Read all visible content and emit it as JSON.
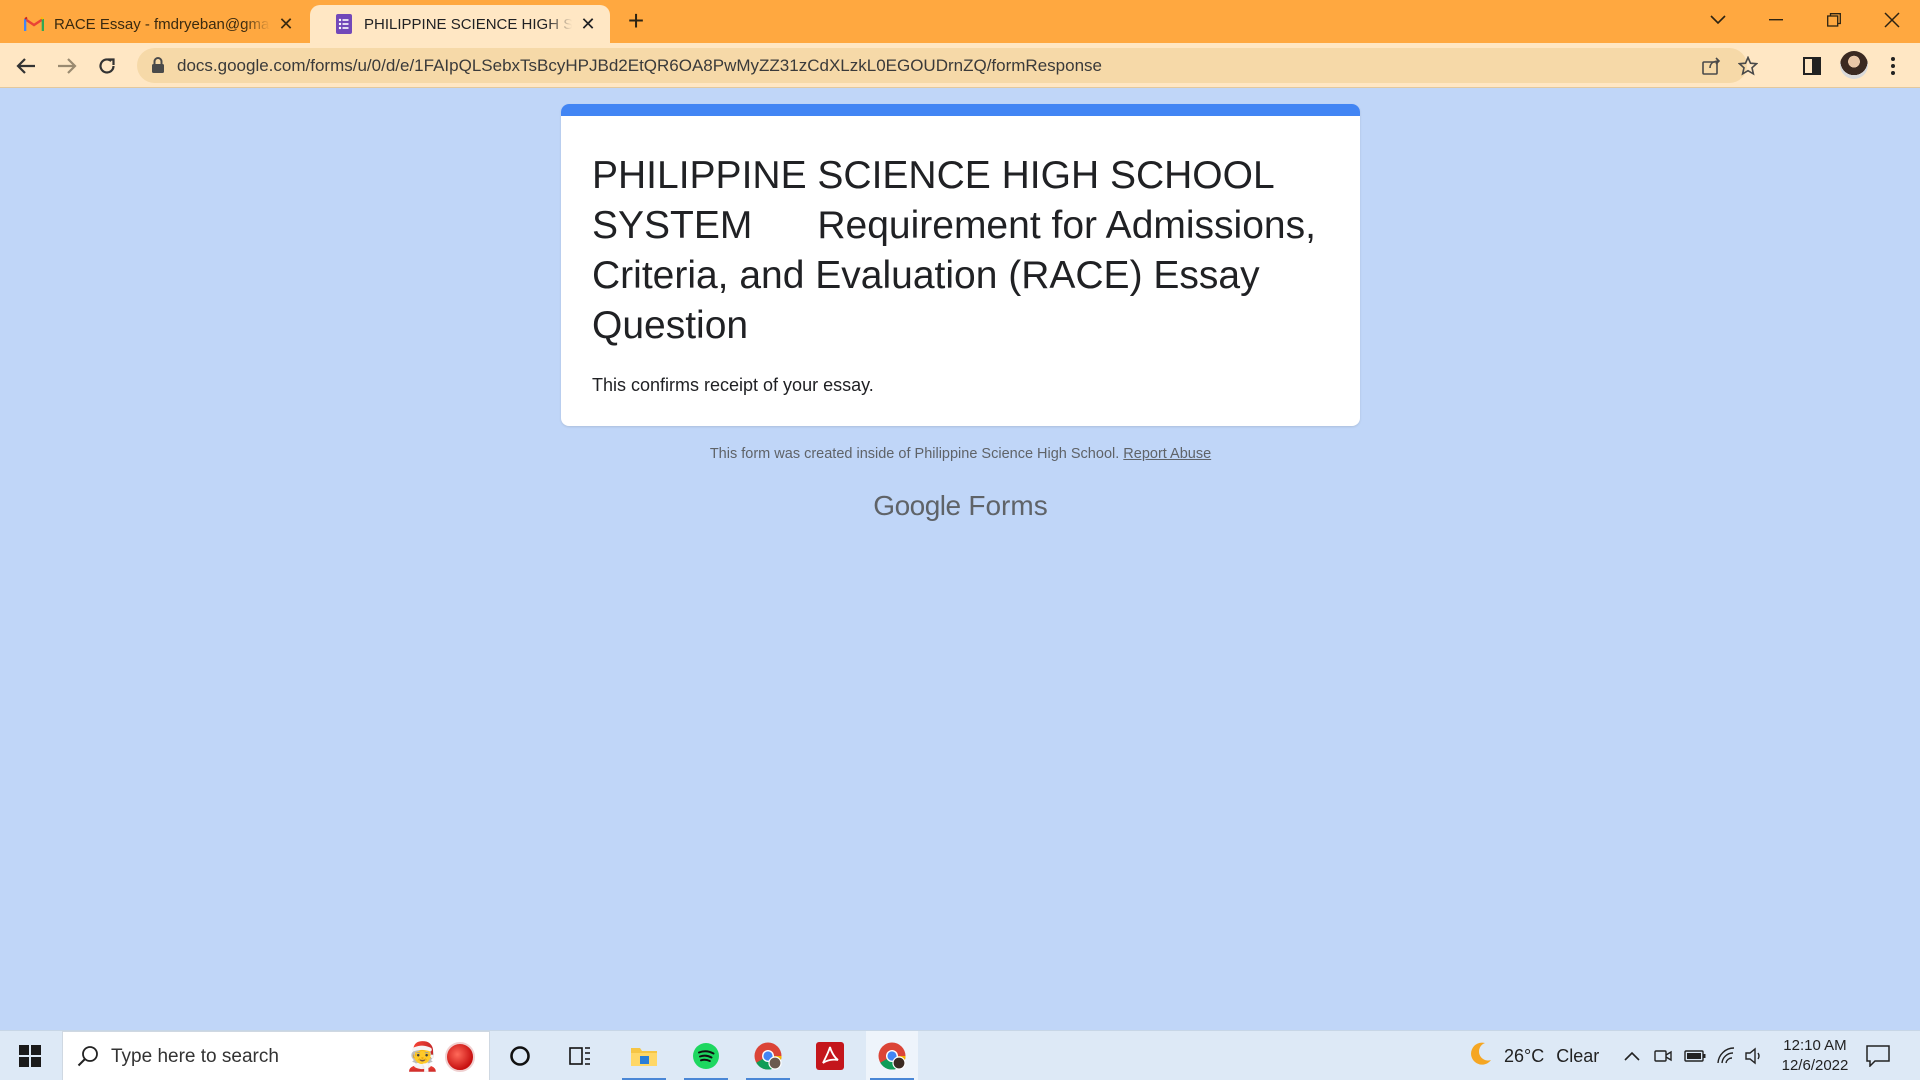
{
  "browser": {
    "tabs": [
      {
        "title": "RACE Essay - fmdryeban@gmail.com",
        "icon": "gmail-icon",
        "active": false
      },
      {
        "title": "PHILIPPINE SCIENCE HIGH SCHOOL SYSTEM",
        "icon": "google-forms-icon",
        "active": true
      }
    ],
    "new_tab_label": "+",
    "address_bar": {
      "url": "docs.google.com/forms/u/0/d/e/1FAIpQLSebxTsBcyHPJBd2EtQR6OA8PwMyZZ31zCdXLzkL0EGOUDrnZQ/formResponse"
    }
  },
  "form": {
    "title": "PHILIPPINE SCIENCE HIGH SCHOOL SYSTEM      Requirement for Admissions, Criteria, and Evaluation (RACE) Essay Question",
    "confirmation_message": "This confirms receipt of your essay.",
    "footer_note": "This form was created inside of Philippine Science High School.",
    "report_abuse_label": "Report Abuse",
    "brand_google": "Google",
    "brand_forms": "Forms",
    "accent_color": "#4285f4",
    "background_color": "#c0d6f8"
  },
  "taskbar": {
    "search_placeholder": "Type here to search",
    "weather_temp": "26°C",
    "weather_condition": "Clear",
    "time": "12:10 AM",
    "date": "12/6/2022",
    "apps": [
      "cortana",
      "task-view",
      "file-explorer",
      "spotify",
      "chrome",
      "acrobat-reader",
      "chrome-profile"
    ]
  }
}
